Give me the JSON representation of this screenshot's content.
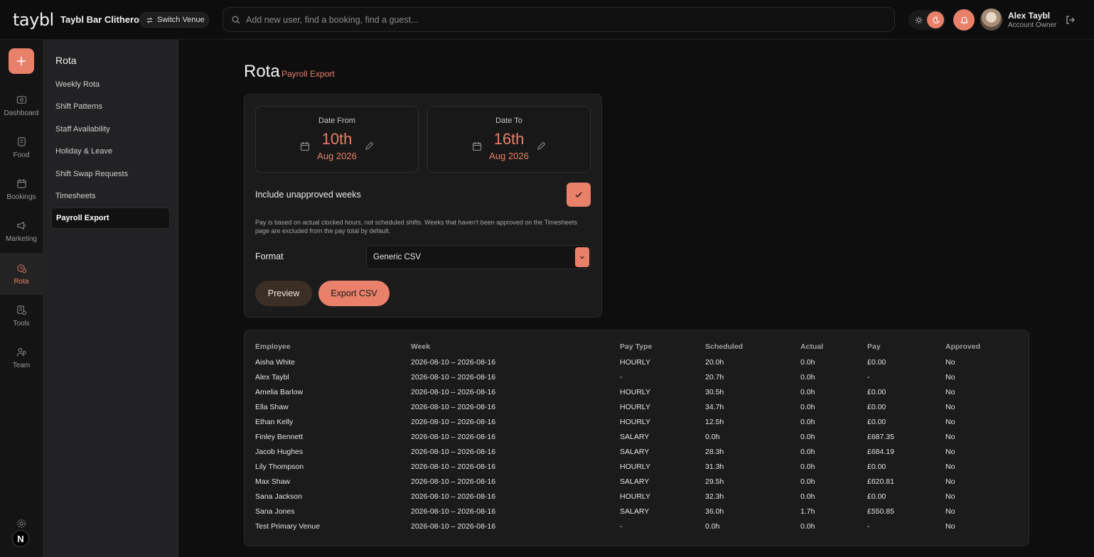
{
  "header": {
    "logo": "taybl",
    "venue_name": "Taybl Bar Clitheroe",
    "switch_venue_label": "Switch Venue",
    "search_placeholder": "Add new user, find a booking, find a guest...",
    "user_name": "Alex Taybl",
    "user_role": "Account Owner"
  },
  "rail": {
    "items": [
      {
        "label": "Dashboard",
        "icon": "dashboard-icon"
      },
      {
        "label": "Food",
        "icon": "food-icon"
      },
      {
        "label": "Bookings",
        "icon": "bookings-icon"
      },
      {
        "label": "Marketing",
        "icon": "megaphone-icon"
      },
      {
        "label": "Rota",
        "icon": "rota-icon",
        "active": true
      },
      {
        "label": "Tools",
        "icon": "tools-icon"
      },
      {
        "label": "Team",
        "icon": "team-icon"
      }
    ],
    "bottom_badge": "N"
  },
  "subnav": {
    "title": "Rota",
    "items": [
      {
        "label": "Weekly Rota"
      },
      {
        "label": "Shift Patterns"
      },
      {
        "label": "Staff Availability"
      },
      {
        "label": "Holiday & Leave"
      },
      {
        "label": "Shift Swap Requests"
      },
      {
        "label": "Timesheets"
      },
      {
        "label": "Payroll Export",
        "active": true
      }
    ]
  },
  "page": {
    "title": "Rota",
    "subtitle": "Payroll Export"
  },
  "export_form": {
    "date_from": {
      "label": "Date From",
      "day": "10th",
      "month": "Aug 2026"
    },
    "date_to": {
      "label": "Date To",
      "day": "16th",
      "month": "Aug 2026"
    },
    "include_unapproved_label": "Include unapproved weeks",
    "include_unapproved_checked": true,
    "note": "Pay is based on actual clocked hours, not scheduled shifts. Weeks that haven't been approved on the Timesheets page are excluded from the pay total by default.",
    "format_label": "Format",
    "format_value": "Generic CSV",
    "preview_label": "Preview",
    "export_label": "Export CSV"
  },
  "table": {
    "columns": [
      "Employee",
      "Week",
      "Pay Type",
      "Scheduled",
      "Actual",
      "Pay",
      "Approved"
    ],
    "rows": [
      [
        "Aisha White",
        "2026-08-10 – 2026-08-16",
        "HOURLY",
        "20.0h",
        "0.0h",
        "£0.00",
        "No"
      ],
      [
        "Alex Taybl",
        "2026-08-10 – 2026-08-16",
        "-",
        "20.7h",
        "0.0h",
        "-",
        "No"
      ],
      [
        "Amelia Barlow",
        "2026-08-10 – 2026-08-16",
        "HOURLY",
        "30.5h",
        "0.0h",
        "£0.00",
        "No"
      ],
      [
        "Ella Shaw",
        "2026-08-10 – 2026-08-16",
        "HOURLY",
        "34.7h",
        "0.0h",
        "£0.00",
        "No"
      ],
      [
        "Ethan Kelly",
        "2026-08-10 – 2026-08-16",
        "HOURLY",
        "12.5h",
        "0.0h",
        "£0.00",
        "No"
      ],
      [
        "Finley Bennett",
        "2026-08-10 – 2026-08-16",
        "SALARY",
        "0.0h",
        "0.0h",
        "£687.35",
        "No"
      ],
      [
        "Jacob Hughes",
        "2026-08-10 – 2026-08-16",
        "SALARY",
        "28.3h",
        "0.0h",
        "£684.19",
        "No"
      ],
      [
        "Lily Thompson",
        "2026-08-10 – 2026-08-16",
        "HOURLY",
        "31.3h",
        "0.0h",
        "£0.00",
        "No"
      ],
      [
        "Max Shaw",
        "2026-08-10 – 2026-08-16",
        "SALARY",
        "29.5h",
        "0.0h",
        "£620.81",
        "No"
      ],
      [
        "Sana Jackson",
        "2026-08-10 – 2026-08-16",
        "HOURLY",
        "32.3h",
        "0.0h",
        "£0.00",
        "No"
      ],
      [
        "Sana Jones",
        "2026-08-10 – 2026-08-16",
        "SALARY",
        "36.0h",
        "1.7h",
        "£550.85",
        "No"
      ],
      [
        "Test Primary Venue",
        "2026-08-10 – 2026-08-16",
        "-",
        "0.0h",
        "0.0h",
        "-",
        "No"
      ]
    ]
  },
  "colors": {
    "accent": "#e8806a",
    "background": "#0e0e0e",
    "sidebar": "#222224"
  }
}
